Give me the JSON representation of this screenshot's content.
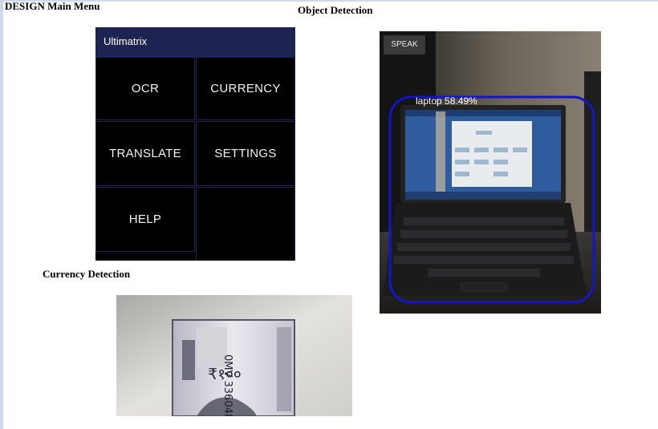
{
  "headings": {
    "design_main_menu": "DESIGN Main Menu",
    "object_detection": "Object Detection",
    "currency_detection": "Currency Detection"
  },
  "main_menu": {
    "app_title": "Ultimatrix",
    "tiles": [
      {
        "label": "OCR"
      },
      {
        "label": "CURRENCY"
      },
      {
        "label": "TRANSLATE"
      },
      {
        "label": "SETTINGS"
      },
      {
        "label": "HELP"
      }
    ],
    "colors": {
      "appbar": "#1d2451",
      "background": "#000000",
      "tile_border": "#1e2550"
    }
  },
  "object_detection": {
    "speak_button": "SPEAK",
    "detection_label": "laptop 58.49%",
    "colors": {
      "box": "#1515c8"
    }
  },
  "currency_detection": {
    "note_text": "₹१००",
    "serial": "0MV 336048"
  }
}
